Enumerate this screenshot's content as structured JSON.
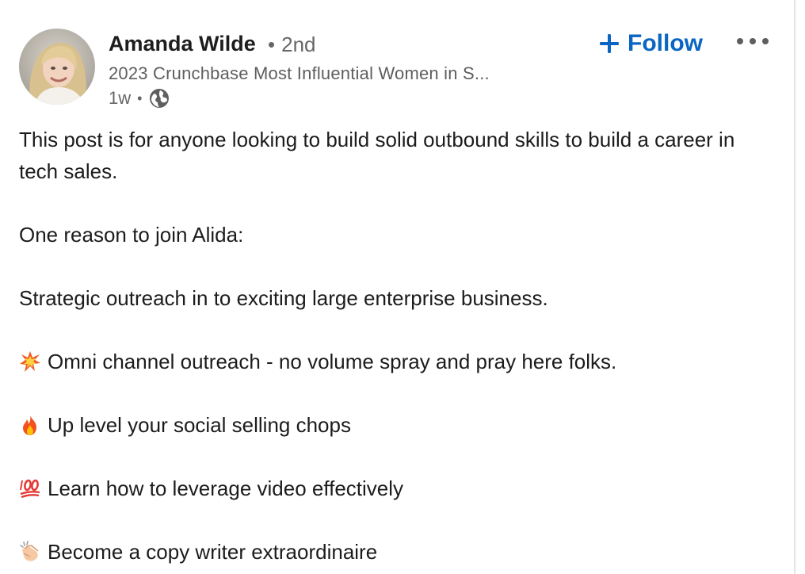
{
  "author": {
    "name": "Amanda Wilde",
    "degree": "2nd",
    "degree_separator": "•",
    "headline": "2023 Crunchbase Most Influential Women in S...",
    "time": "1w",
    "time_separator": "•",
    "visibility_icon": "globe-icon"
  },
  "actions": {
    "follow_label": "Follow",
    "follow_icon": "plus-icon",
    "more_icon": "more-options-icon"
  },
  "post": {
    "intro": "This post is for anyone looking to build solid outbound skills to build a career in tech sales.",
    "reason_heading": "One reason to join Alida:",
    "strategic": "Strategic outreach in to exciting large enterprise business.",
    "bullets": [
      {
        "icon": "collision-emoji-icon",
        "text": "Omni channel outreach - no volume spray and pray here folks."
      },
      {
        "icon": "fire-emoji-icon",
        "text": "Up level your social selling chops"
      },
      {
        "icon": "hundred-points-emoji-icon",
        "text": "Learn how to leverage video effectively"
      },
      {
        "icon": "clapping-hands-emoji-icon",
        "text": "Become a copy writer extraordinaire"
      }
    ]
  },
  "colors": {
    "accent": "#0a66c2",
    "text": "#1c1c1c",
    "muted": "#666666"
  }
}
